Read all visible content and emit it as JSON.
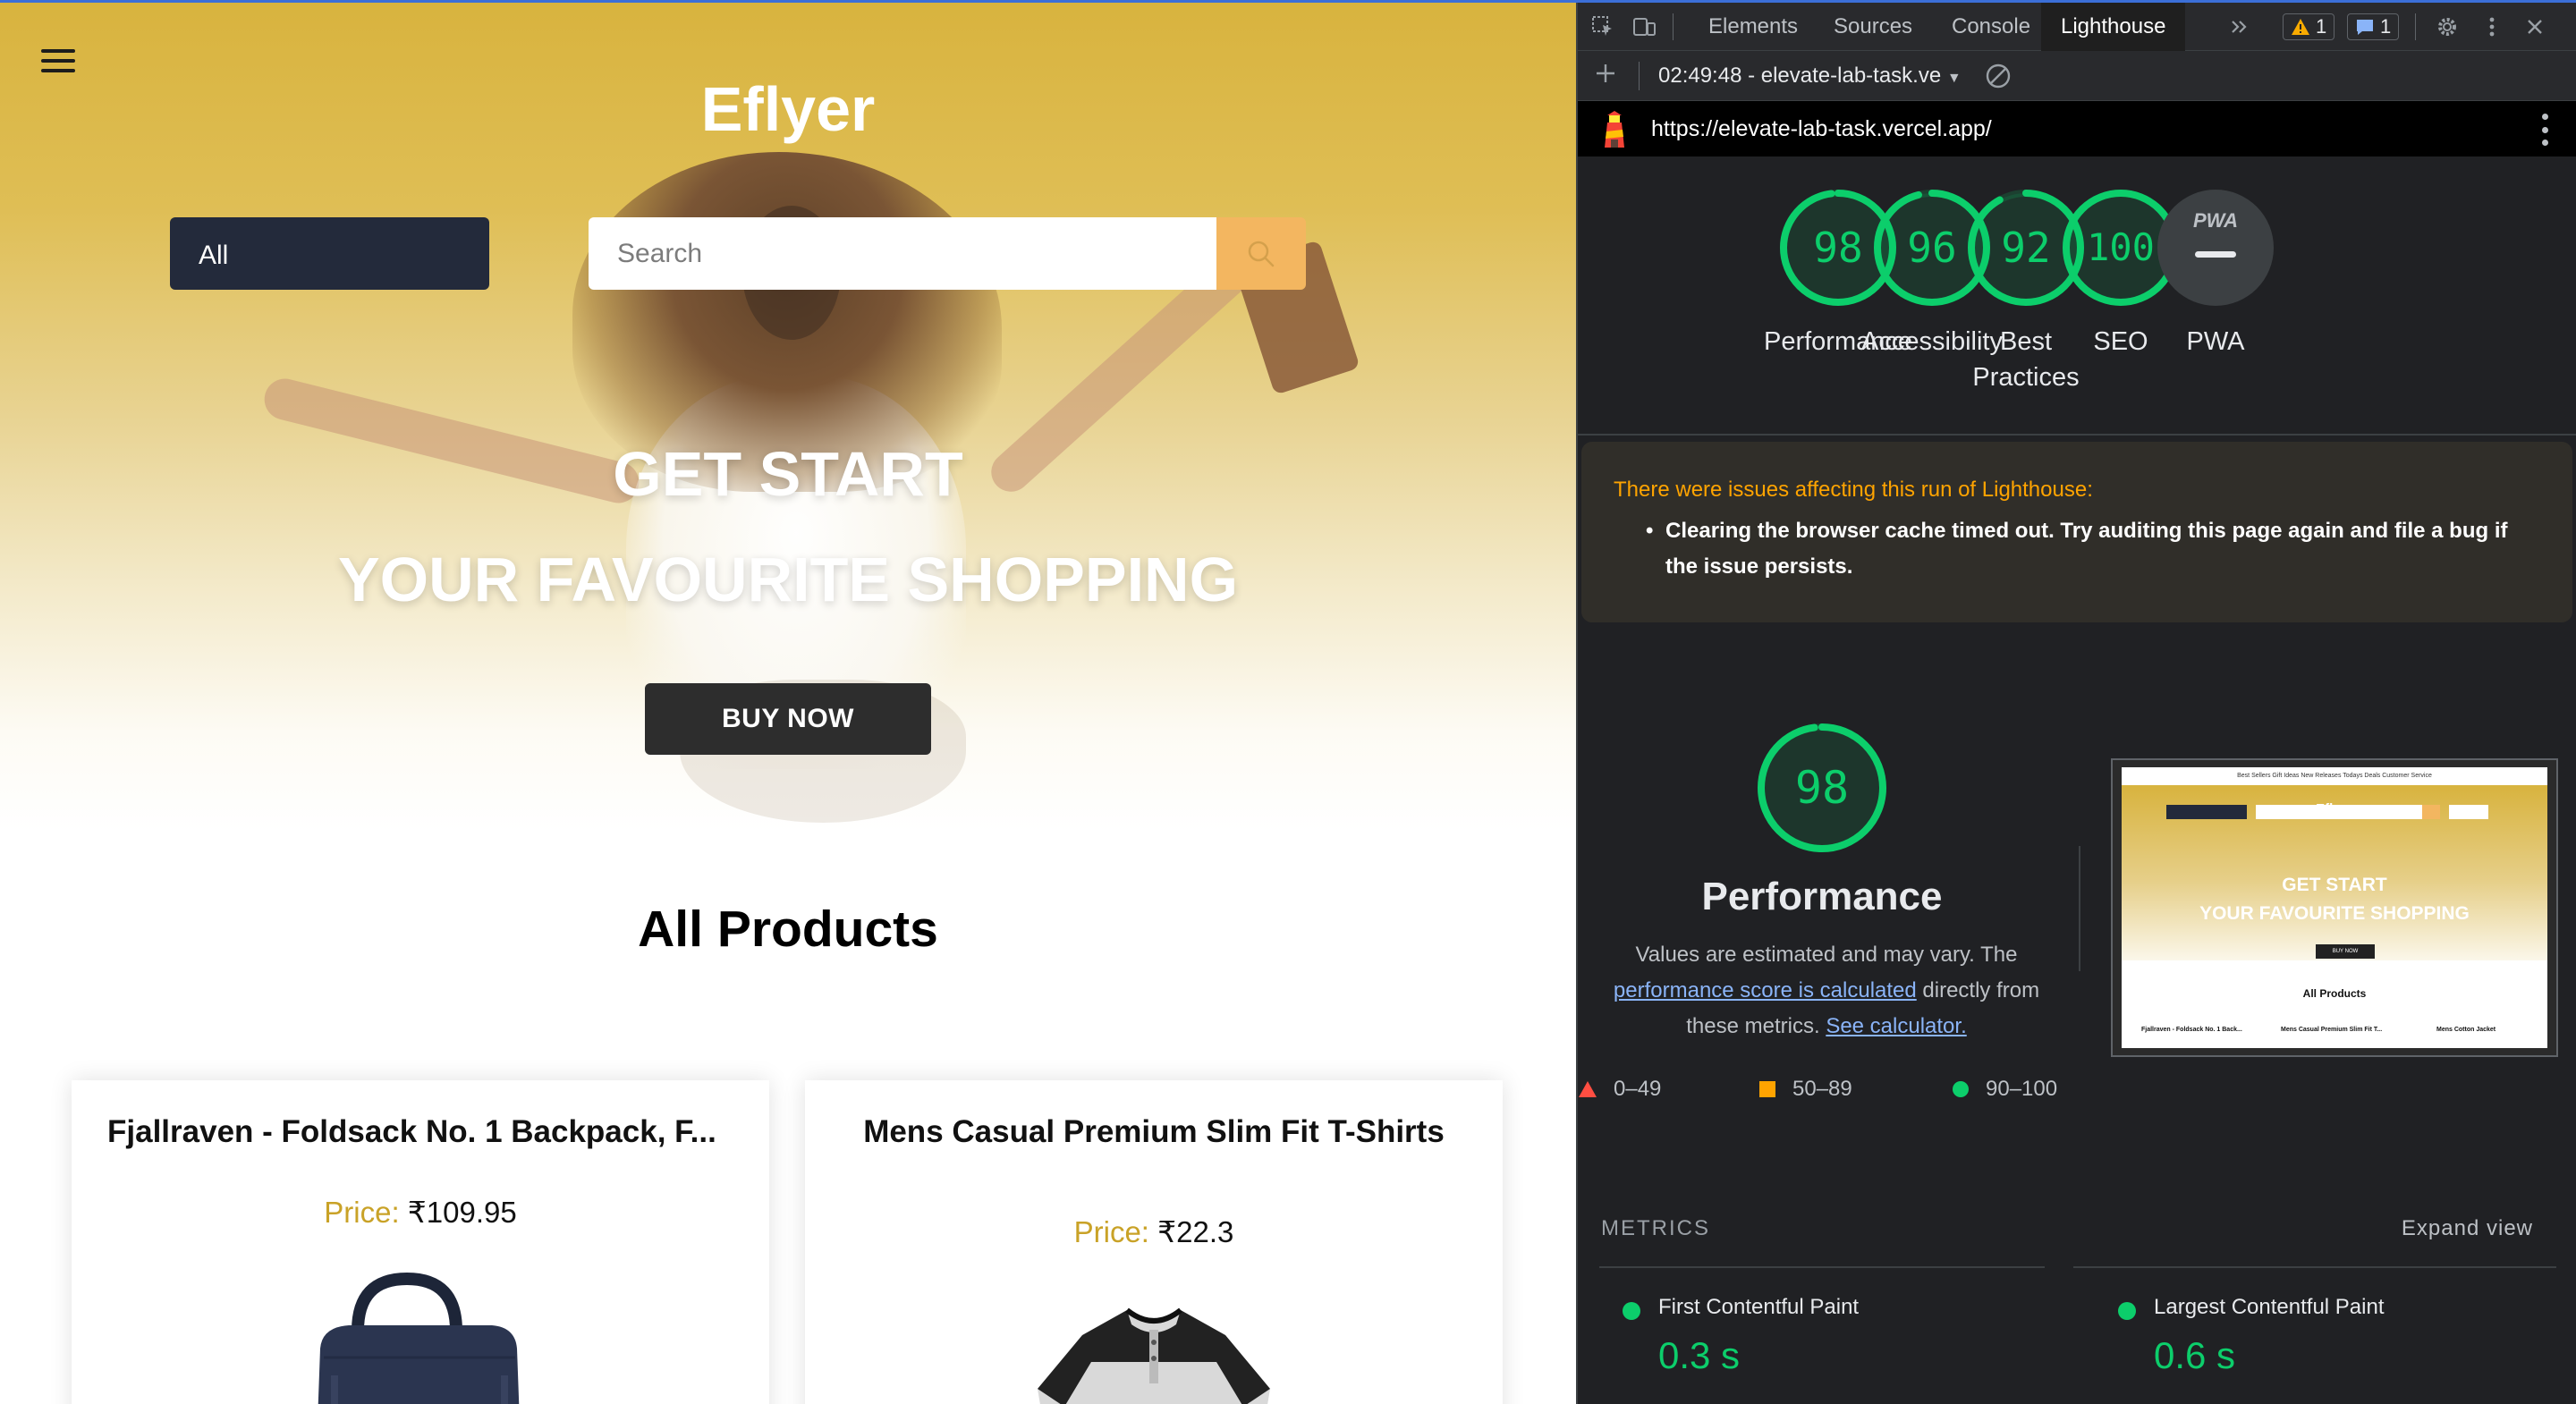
{
  "site": {
    "brand": "Eflyer",
    "category_select": "All",
    "search_placeholder": "Search",
    "hero_line1": "GET START",
    "hero_line2": "YOUR FAVOURITE SHOPPING",
    "buy_button": "BUY NOW",
    "section_title": "All Products",
    "products": [
      {
        "title": "Fjallraven - Foldsack No. 1 Backpack, F...",
        "price_label": "Price:",
        "price": "₹109.95"
      },
      {
        "title": "Mens Casual Premium Slim Fit T-Shirts",
        "price_label": "Price:",
        "price": "₹22.3"
      }
    ]
  },
  "devtools": {
    "tabs": [
      "Elements",
      "Sources",
      "Console",
      "Lighthouse"
    ],
    "active_tab": "Lighthouse",
    "warning_count": "1",
    "message_count": "1",
    "report_select": "02:49:48 - elevate-lab-task.ve",
    "url": "https://elevate-lab-task.vercel.app/",
    "gauges": [
      {
        "score": "98",
        "label": "Performance",
        "fraction": 0.98
      },
      {
        "score": "96",
        "label": "Accessibility",
        "fraction": 0.96
      },
      {
        "score": "92",
        "label": "Best Practices",
        "fraction": 0.92
      },
      {
        "score": "100",
        "label": "SEO",
        "fraction": 1.0
      },
      {
        "score": "PWA",
        "label": "PWA",
        "fraction": 0
      }
    ],
    "warning": {
      "title": "There were issues affecting this run of Lighthouse:",
      "bullet": "Clearing the browser cache timed out. Try auditing this page again and file a bug if the issue persists."
    },
    "performance": {
      "score": "98",
      "title": "Performance",
      "desc_1": "Values are estimated and may vary. The",
      "link_1": "performance score is calculated",
      "desc_2": "directly from these metrics.",
      "link_2": "See calculator."
    },
    "legend": [
      "0–49",
      "50–89",
      "90–100"
    ],
    "thumbnail": {
      "nav": "Best Sellers   Gift Ideas   New Releases   Todays Deals   Customer Service",
      "brand": "Eflyer",
      "line1": "GET START",
      "line2": "YOUR FAVOURITE SHOPPING",
      "button": "BUY NOW",
      "title": "All Products",
      "cards": [
        "Fjallraven - Foldsack No. 1 Back...",
        "Mens Casual Premium Slim Fit T...",
        "Mens Cotton Jacket"
      ]
    },
    "metrics_heading": "METRICS",
    "expand_view": "Expand view",
    "metrics": [
      {
        "name": "First Contentful Paint",
        "value": "0.3 s"
      },
      {
        "name": "Largest Contentful Paint",
        "value": "0.6 s"
      }
    ],
    "colors": {
      "pass": "#0cce6b",
      "average": "#ffa400",
      "fail": "#ff4e42",
      "link": "#8ab4f8"
    }
  }
}
